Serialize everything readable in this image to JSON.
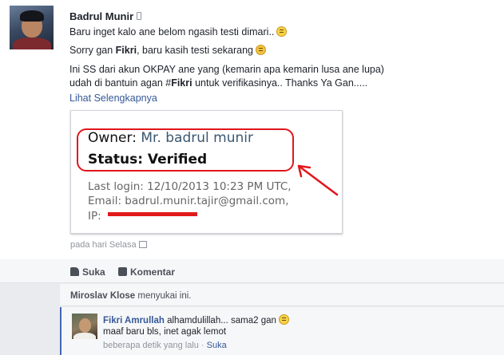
{
  "post": {
    "author": "Badrul Munir",
    "line1": "Baru inget kalo ane belom ngasih testi dimari..",
    "line2_a": "Sorry gan ",
    "line2_bold": "Fikri",
    "line2_b": ", baru kasih testi sekarang",
    "line3": "Ini SS dari akun OKPAY ane yang (kemarin apa kemarin lusa ane lupa)",
    "line4_a": "udah di bantuin agan #",
    "line4_bold": "Fikri",
    "line4_b": " untuk verifikasinya.. Thanks Ya Gan.....",
    "see_more": "Lihat Selengkapnya",
    "timestamp": "pada hari Selasa"
  },
  "screenshot": {
    "owner_label": "Owner:",
    "owner_value": "Mr. badrul munir",
    "status_label": "Status: Verified",
    "last_login": "Last login: 12/10/2013 10:23 PM UTC,",
    "email": "Email: badrul.munir.tajir@gmail.com,",
    "ip_label": "IP:",
    "annotation_color": "#e0161c"
  },
  "actions": {
    "like": "Suka",
    "comment": "Komentar"
  },
  "likes": {
    "name": "Miroslav Klose",
    "suffix": " menyukai ini."
  },
  "comment": {
    "name": "Fikri Amrullah",
    "text1": " alhamdulillah... sama2 gan",
    "text2": "maaf baru bls, inet agak lemot",
    "time": "beberapa detik yang lalu",
    "sep": " · ",
    "like": "Suka"
  }
}
